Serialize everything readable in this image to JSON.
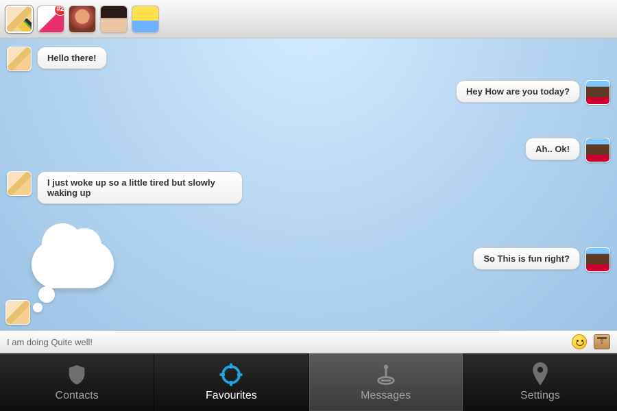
{
  "topbar": {
    "avatars": [
      {
        "name": "avatar-1",
        "badge": null,
        "selected": true,
        "editing": true
      },
      {
        "name": "avatar-2",
        "badge": "#2",
        "selected": false,
        "editing": false
      },
      {
        "name": "avatar-3",
        "badge": null,
        "selected": false,
        "editing": false
      },
      {
        "name": "avatar-4",
        "badge": null,
        "selected": false,
        "editing": false
      },
      {
        "name": "avatar-5",
        "badge": null,
        "selected": false,
        "editing": false
      }
    ]
  },
  "chat": {
    "messages": [
      {
        "side": "left",
        "text": "Hello there!"
      },
      {
        "side": "right",
        "text": "Hey How are you today?"
      },
      {
        "side": "right",
        "text": "Ah.. Ok!"
      },
      {
        "side": "left",
        "text": "I just woke up so a little tired but slowly waking up"
      },
      {
        "side": "right",
        "text": "So This is fun right?"
      }
    ],
    "typing": true
  },
  "input": {
    "value": "I am doing Quite well!",
    "emoji_icon": "smiley-icon",
    "attach_icon": "box-upload-icon"
  },
  "tabs": {
    "items": [
      {
        "label": "Contacts",
        "icon": "shield-icon",
        "active": false,
        "highlight": false
      },
      {
        "label": "Favourites",
        "icon": "target-icon",
        "active": true,
        "highlight": false
      },
      {
        "label": "Messages",
        "icon": "joystick-icon",
        "active": false,
        "highlight": true
      },
      {
        "label": "Settings",
        "icon": "pin-icon",
        "active": false,
        "highlight": false
      }
    ]
  },
  "colors": {
    "accent": "#1fa6e0",
    "chat_bg": "#b3d4ef",
    "tabbar_bg": "#1a1a1a"
  }
}
